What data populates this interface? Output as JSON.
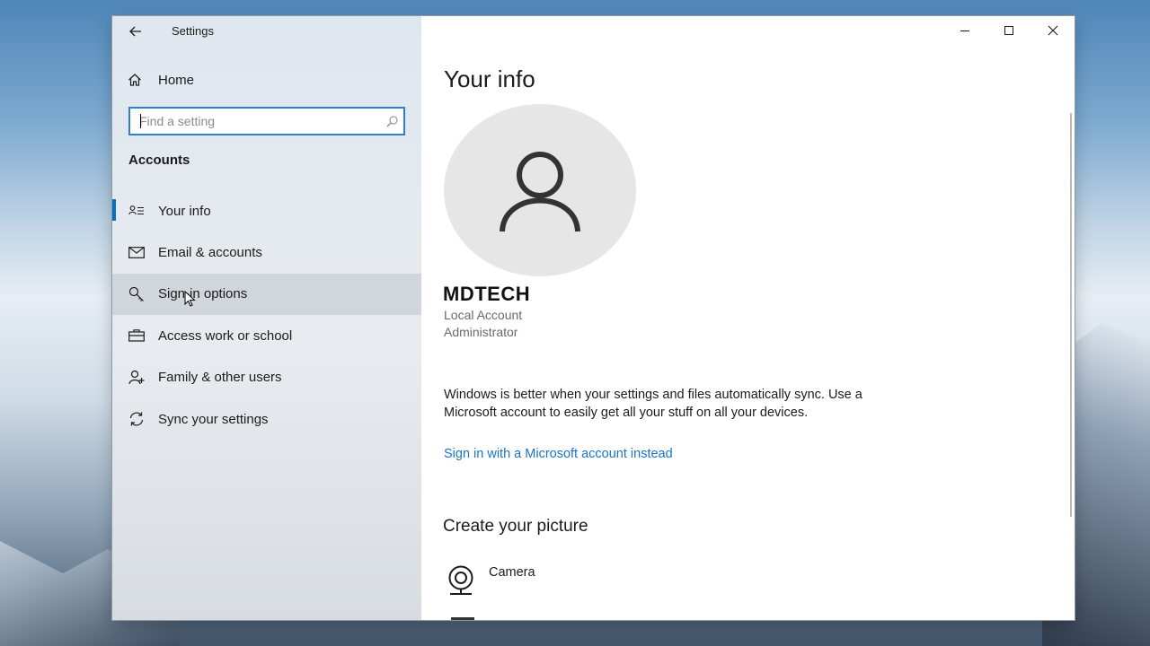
{
  "window": {
    "title": "Settings"
  },
  "nav": {
    "home_label": "Home",
    "search_placeholder": "Find a setting",
    "section_heading": "Accounts",
    "items": [
      {
        "label": "Your info",
        "icon": "contact-card-icon",
        "selected": true
      },
      {
        "label": "Email & accounts",
        "icon": "mail-icon"
      },
      {
        "label": "Sign-in options",
        "icon": "key-icon",
        "hover": true
      },
      {
        "label": "Access work or school",
        "icon": "briefcase-icon"
      },
      {
        "label": "Family & other users",
        "icon": "add-person-icon"
      },
      {
        "label": "Sync your settings",
        "icon": "sync-icon"
      }
    ]
  },
  "main": {
    "title": "Your info",
    "user": {
      "name": "MDTECH",
      "account_type": "Local Account",
      "role": "Administrator"
    },
    "sync_message": "Windows is better when your settings and files automatically sync. Use a Microsoft account to easily get all your stuff on all your devices.",
    "ms_link": "Sign in with a Microsoft account instead",
    "picture_heading": "Create your picture",
    "picture_options": [
      {
        "label": "Camera",
        "icon": "camera-icon"
      }
    ]
  },
  "colors": {
    "accent": "#0a6dc2",
    "link": "#1a73c8",
    "focus_border": "#2f7fd0"
  }
}
